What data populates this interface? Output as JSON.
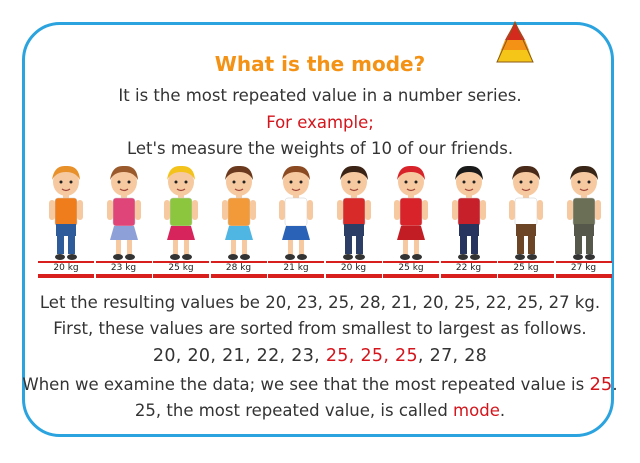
{
  "title": "What is the mode?",
  "line1": "It is the most repeated value in a number series.",
  "line2": "For example;",
  "line3": "Let's measure the weights of 10 of our friends.",
  "weights": [
    "20 kg",
    "23 kg",
    "25 kg",
    "28 kg",
    "21 kg",
    "20 kg",
    "25 kg",
    "22 kg",
    "25 kg",
    "27 kg"
  ],
  "line4": "Let the resulting values be 20, 23, 25, 28, 21, 20, 25, 22, 25, 27 kg.",
  "line5": "First, these values are sorted from smallest to largest as follows.",
  "sorted_pre": "20, 20, 21, 22, 23, ",
  "sorted_mode": "25, 25, 25",
  "sorted_post": ", 27, 28",
  "line7_pre": "When we examine the data; we see that the most repeated value is ",
  "line7_value": "25",
  "line7_post": ".",
  "line8_pre": "25, the most repeated value, is called ",
  "line8_term": "mode",
  "line8_post": ".",
  "colors": {
    "border": "#2aa3df",
    "title": "#f39214",
    "highlight": "#d4151c",
    "text": "#333333"
  },
  "kids": [
    {
      "hair": "#e8902a",
      "shirt": "#f07d1b",
      "bottom": "#2e5b9a",
      "skirt": false
    },
    {
      "hair": "#9a5a2b",
      "shirt": "#e0457a",
      "bottom": "#8ea0d8",
      "skirt": true
    },
    {
      "hair": "#f3c21b",
      "shirt": "#8cc63f",
      "bottom": "#d8245c",
      "skirt": true
    },
    {
      "hair": "#6b3a1e",
      "shirt": "#f29a3a",
      "bottom": "#4fb5e3",
      "skirt": true
    },
    {
      "hair": "#8b4a22",
      "shirt": "#ffffff",
      "bottom": "#2a62b8",
      "skirt": true
    },
    {
      "hair": "#3b2416",
      "shirt": "#d92a2a",
      "bottom": "#2c3e66",
      "skirt": false
    },
    {
      "hair": "#d9232a",
      "shirt": "#d9232a",
      "bottom": "#c21d24",
      "skirt": true
    },
    {
      "hair": "#1a1a1a",
      "shirt": "#c8202a",
      "bottom": "#26345e",
      "skirt": false
    },
    {
      "hair": "#4a2a18",
      "shirt": "#ffffff",
      "bottom": "#6b4525",
      "skirt": false
    },
    {
      "hair": "#3a2616",
      "shirt": "#6b6f55",
      "bottom": "#55584a",
      "skirt": false
    }
  ]
}
